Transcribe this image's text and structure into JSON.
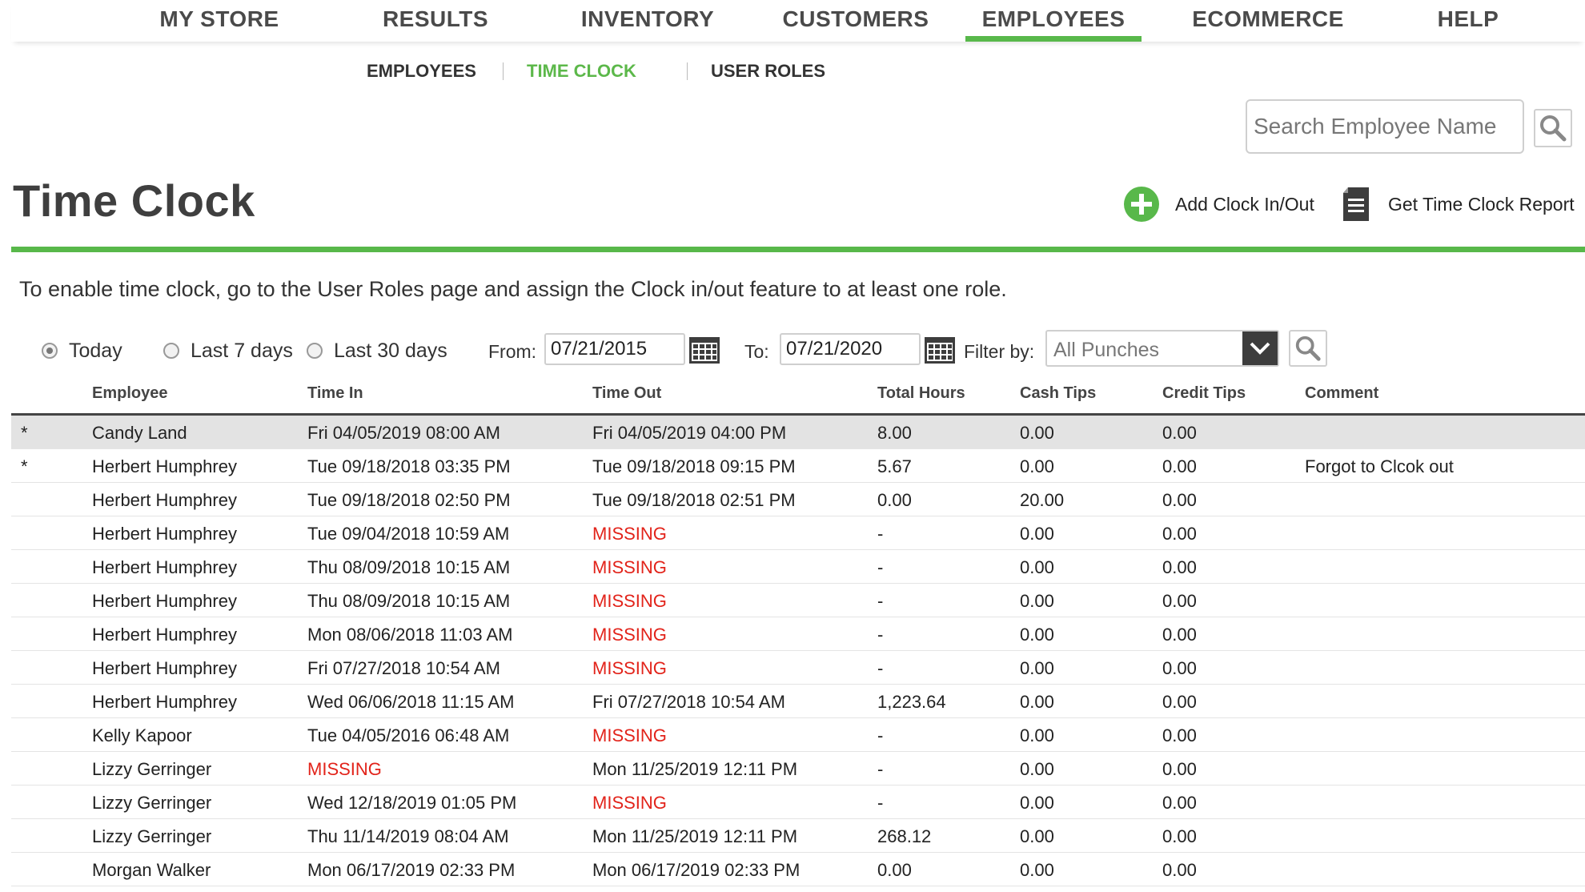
{
  "nav": {
    "items": [
      "MY STORE",
      "RESULTS",
      "INVENTORY",
      "CUSTOMERS",
      "EMPLOYEES",
      "ECOMMERCE",
      "HELP"
    ],
    "active": "EMPLOYEES"
  },
  "subnav": {
    "items": [
      "EMPLOYEES",
      "TIME CLOCK",
      "USER ROLES"
    ],
    "active": "TIME CLOCK"
  },
  "search": {
    "placeholder": "Search Employee Name",
    "icon": "search-icon"
  },
  "page": {
    "title": "Time Clock",
    "add_label": "Add Clock In/Out",
    "report_label": "Get Time Clock Report",
    "notice": "To enable time clock, go to the User Roles page and assign the Clock in/out feature to at least one role."
  },
  "filters": {
    "radios": [
      "Today",
      "Last 7 days",
      "Last 30 days"
    ],
    "selected_radio": "Today",
    "from_label": "From:",
    "from_value": "07/21/2015",
    "to_label": "To:",
    "to_value": "07/21/2020",
    "filter_label": "Filter by:",
    "filter_value": "All Punches"
  },
  "table": {
    "columns": [
      "Employee",
      "Time In",
      "Time Out",
      "Total Hours",
      "Cash Tips",
      "Credit Tips",
      "Comment"
    ],
    "rows": [
      {
        "flag": "*",
        "employee": "Candy Land",
        "time_in": "Fri 04/05/2019 08:00 AM",
        "time_out": "Fri 04/05/2019 04:00 PM",
        "hours": "8.00",
        "cash": "0.00",
        "credit": "0.00",
        "comment": ""
      },
      {
        "flag": "*",
        "employee": "Herbert Humphrey",
        "time_in": "Tue 09/18/2018 03:35 PM",
        "time_out": "Tue 09/18/2018 09:15 PM",
        "hours": "5.67",
        "cash": "0.00",
        "credit": "0.00",
        "comment": "Forgot to Clcok out"
      },
      {
        "flag": "",
        "employee": "Herbert Humphrey",
        "time_in": "Tue 09/18/2018 02:50 PM",
        "time_out": "Tue 09/18/2018 02:51 PM",
        "hours": "0.00",
        "cash": "20.00",
        "credit": "0.00",
        "comment": ""
      },
      {
        "flag": "",
        "employee": "Herbert Humphrey",
        "time_in": "Tue 09/04/2018 10:59 AM",
        "time_out": "MISSING",
        "hours": "-",
        "cash": "0.00",
        "credit": "0.00",
        "comment": ""
      },
      {
        "flag": "",
        "employee": "Herbert Humphrey",
        "time_in": "Thu 08/09/2018 10:15 AM",
        "time_out": "MISSING",
        "hours": "-",
        "cash": "0.00",
        "credit": "0.00",
        "comment": ""
      },
      {
        "flag": "",
        "employee": "Herbert Humphrey",
        "time_in": "Thu 08/09/2018 10:15 AM",
        "time_out": "MISSING",
        "hours": "-",
        "cash": "0.00",
        "credit": "0.00",
        "comment": ""
      },
      {
        "flag": "",
        "employee": "Herbert Humphrey",
        "time_in": "Mon 08/06/2018 11:03 AM",
        "time_out": "MISSING",
        "hours": "-",
        "cash": "0.00",
        "credit": "0.00",
        "comment": ""
      },
      {
        "flag": "",
        "employee": "Herbert Humphrey",
        "time_in": "Fri 07/27/2018 10:54 AM",
        "time_out": "MISSING",
        "hours": "-",
        "cash": "0.00",
        "credit": "0.00",
        "comment": ""
      },
      {
        "flag": "",
        "employee": "Herbert Humphrey",
        "time_in": "Wed 06/06/2018 11:15 AM",
        "time_out": "Fri 07/27/2018 10:54 AM",
        "hours": "1,223.64",
        "cash": "0.00",
        "credit": "0.00",
        "comment": ""
      },
      {
        "flag": "",
        "employee": "Kelly Kapoor",
        "time_in": "Tue 04/05/2016 06:48 AM",
        "time_out": "MISSING",
        "hours": "-",
        "cash": "0.00",
        "credit": "0.00",
        "comment": ""
      },
      {
        "flag": "",
        "employee": "Lizzy Gerringer",
        "time_in": "MISSING",
        "time_out": "Mon 11/25/2019 12:11 PM",
        "hours": "-",
        "cash": "0.00",
        "credit": "0.00",
        "comment": ""
      },
      {
        "flag": "",
        "employee": "Lizzy Gerringer",
        "time_in": "Wed 12/18/2019 01:05 PM",
        "time_out": "MISSING",
        "hours": "-",
        "cash": "0.00",
        "credit": "0.00",
        "comment": ""
      },
      {
        "flag": "",
        "employee": "Lizzy Gerringer",
        "time_in": "Thu 11/14/2019 08:04 AM",
        "time_out": "Mon 11/25/2019 12:11 PM",
        "hours": "268.12",
        "cash": "0.00",
        "credit": "0.00",
        "comment": ""
      },
      {
        "flag": "",
        "employee": "Morgan Walker",
        "time_in": "Mon 06/17/2019 02:33 PM",
        "time_out": "Mon 06/17/2019 02:33 PM",
        "hours": "0.00",
        "cash": "0.00",
        "credit": "0.00",
        "comment": ""
      }
    ]
  },
  "colors": {
    "accent": "#58b84a",
    "missing": "#e2231a",
    "text": "#222222"
  }
}
